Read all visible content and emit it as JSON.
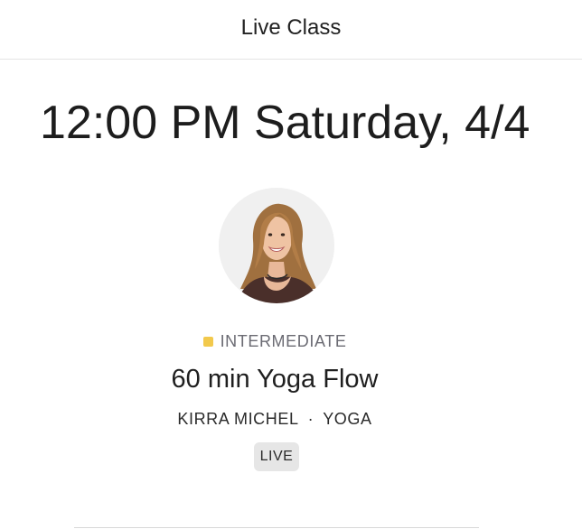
{
  "header": {
    "title": "Live Class"
  },
  "schedule": {
    "datetime": "12:00 PM Saturday, 4/4"
  },
  "instructor_avatar": {
    "icon": "instructor-photo"
  },
  "class": {
    "level": "INTERMEDIATE",
    "level_color": "#f2c94c",
    "title": "60 min Yoga Flow",
    "instructor": "KIRRA MICHEL",
    "separator": "·",
    "discipline": "YOGA",
    "badge": "LIVE"
  }
}
